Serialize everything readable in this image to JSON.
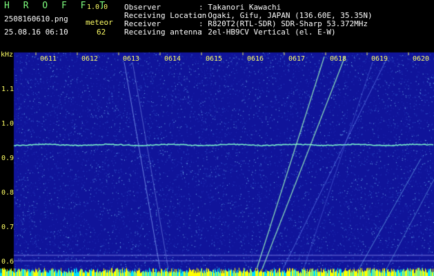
{
  "app": {
    "name": "H R O F F T",
    "version": "1.0.0"
  },
  "file": {
    "name": "2508160610.png",
    "datetime": "25.08.16 06:10"
  },
  "meteor": {
    "label": "meteor",
    "count": "62"
  },
  "info": {
    "rows": [
      {
        "label": "Observer",
        "value": ": Takanori Kawachi"
      },
      {
        "label": "Receiving Location",
        "value": ": Ogaki, Gifu, JAPAN (136.60E, 35.35N)"
      },
      {
        "label": "Receiver",
        "value": ": R820T2(RTL-SDR) SDR-Sharp 53.372MHz"
      },
      {
        "label": "Receiving antenna",
        "value": ": 2el-HB9CV Vertical (el. E-W)"
      }
    ]
  },
  "axis": {
    "unit": "kHz",
    "y_ticks": [
      "1.1",
      "1.0",
      "0.9",
      "0.8",
      "0.7",
      "0.6"
    ],
    "time_ticks": [
      "0611",
      "0612",
      "0613",
      "0614",
      "0615",
      "0616",
      "0617",
      "0618",
      "0619",
      "0620"
    ]
  },
  "colors": {
    "background": "#10149a",
    "noise_bright": "#7fd0ff",
    "carrier": "#7fffd0",
    "meteor_trail": "#a0ffc0",
    "baseline": "#ffff00",
    "header_text": "#ffffff",
    "title_text": "#7fff7f"
  }
}
